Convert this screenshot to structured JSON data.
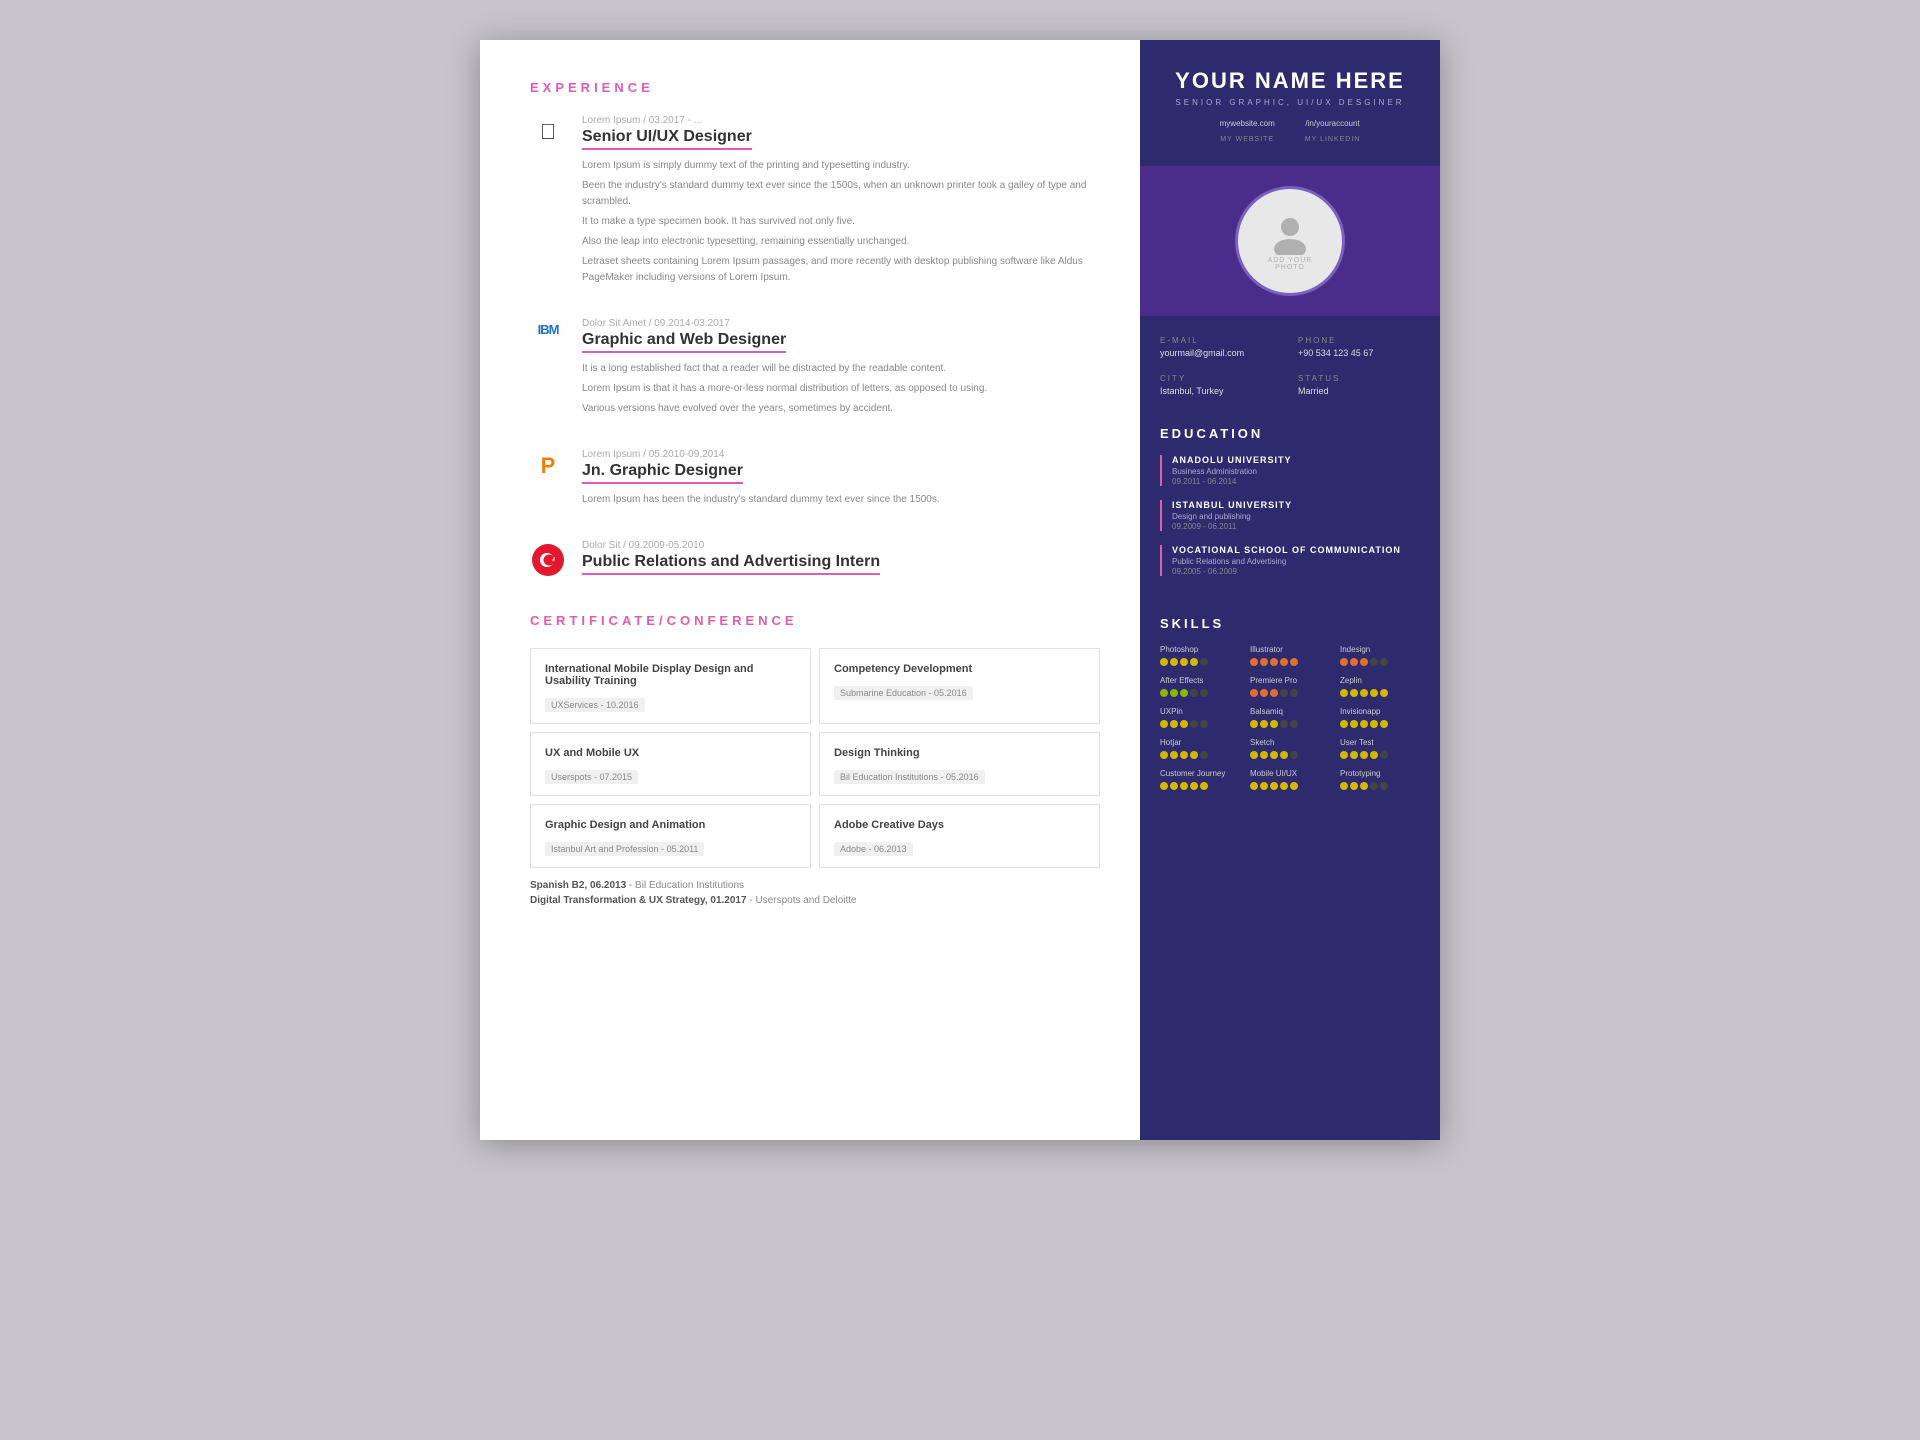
{
  "resume": {
    "left": {
      "experience_title": "EXPERIENCE",
      "items": [
        {
          "company": "Lorem Ipsum",
          "date": "Lorem Ipsum / 03.2017 - ...",
          "role": "Senior UI/UX Designer",
          "logo_type": "apple",
          "descriptions": [
            "Lorem Ipsum is simply dummy text of the printing and typesetting industry.",
            "Been the industry's standard dummy text ever since the 1500s, when an unknown printer took a galley of type and scrambled.",
            "It to make a type specimen book. It has survived not only five.",
            "Also the leap into electronic typesetting, remaining essentially unchanged.",
            "Letraset sheets containing Lorem Ipsum passages, and more recently with desktop publishing software like Aldus PageMaker including versions of Lorem Ipsum."
          ]
        },
        {
          "company": "IBM",
          "date": "Dolor Sit Amet / 09.2014-03.2017",
          "role": "Graphic and Web Designer",
          "logo_type": "ibm",
          "descriptions": [
            "It is a long established fact that a reader will be distracted by the readable content.",
            "Lorem Ipsum is that it has a more-or-less normal distribution of letters, as opposed to using.",
            "Various versions have evolved over the years, sometimes by accident."
          ]
        },
        {
          "company": "Lorem Ipsum",
          "date": "Lorem Ipsum / 05.2010-09.2014",
          "role": "Jn. Graphic Designer",
          "logo_type": "p",
          "descriptions": [
            "Lorem Ipsum has been the industry's standard dummy text ever since the 1500s."
          ]
        },
        {
          "company": "Dolor Sit",
          "date": "Dolor Sit / 09.2009-05.2010",
          "role": "Public Relations and Advertising Intern",
          "logo_type": "turkish",
          "descriptions": []
        }
      ],
      "cert_title": "CERTIFICATE/CONFERENCE",
      "certs": [
        {
          "name": "International Mobile Display Design and Usability Training",
          "org": "UXServices - 10.2016"
        },
        {
          "name": "Competency Development",
          "org": "Submarine Education - 05.2016"
        },
        {
          "name": "UX and Mobile UX",
          "org": "Userspots - 07.2015"
        },
        {
          "name": "Design Thinking",
          "org": "Bil Education Institutions - 05.2016"
        },
        {
          "name": "Graphic Design and Animation",
          "org": "Istanbul Art and Profession - 05.2011"
        },
        {
          "name": "Adobe Creative Days",
          "org": "Adobe - 06.2013"
        }
      ],
      "language_label": "Spanish B2, 06.2013",
      "language_org": "- Bil Education Institutions",
      "digital_label": "Digital Transformation & UX Strategy, 01.2017",
      "digital_org": "- Userspots and Deloitte"
    },
    "right": {
      "name": "YOUR NAME HERE",
      "subtitle": "Senior Graphic, UI/UX Desginer",
      "website_url": "mywebsite.com",
      "website_label": "MY WEBSITE",
      "linkedin_url": "/in/youraccount",
      "linkedin_label": "MY LINKEDIN",
      "photo_text1": "ADD YOUR",
      "photo_text2": "PHOTO",
      "email_label": "E-MAIL",
      "email_value": "yourmail@gmail.com",
      "phone_label": "PHONE",
      "phone_value": "+90 534 123 45 67",
      "city_label": "CITY",
      "city_value": "Istanbul, Turkey",
      "status_label": "STATUS",
      "status_value": "Married",
      "education_title": "EDUCATION",
      "education_items": [
        {
          "school": "Anadolu University",
          "degree": "Business Administration",
          "date": "09.2011 - 06.2014"
        },
        {
          "school": "Istanbul University",
          "degree": "Design and publishing",
          "date": "09.2009 - 06.2011"
        },
        {
          "school": "Vocational School of Communication",
          "degree": "Public Relations and Advertising",
          "date": "09.2005 - 06.2009"
        }
      ],
      "skills_title": "SKILLS",
      "skills": [
        {
          "name": "Photoshop",
          "filled": 4,
          "total": 5,
          "color": "yellow"
        },
        {
          "name": "Illustrator",
          "filled": 5,
          "total": 5,
          "color": "orange"
        },
        {
          "name": "Indesign",
          "filled": 3,
          "total": 5,
          "color": "orange"
        },
        {
          "name": "After Effects",
          "filled": 3,
          "total": 5,
          "color": "green"
        },
        {
          "name": "Premiere Pro",
          "filled": 3,
          "total": 5,
          "color": "orange"
        },
        {
          "name": "Zeplin",
          "filled": 5,
          "total": 5,
          "color": "yellow"
        },
        {
          "name": "UXPin",
          "filled": 3,
          "total": 5,
          "color": "yellow"
        },
        {
          "name": "Balsamiq",
          "filled": 3,
          "total": 5,
          "color": "yellow"
        },
        {
          "name": "Invisionapp",
          "filled": 5,
          "total": 5,
          "color": "yellow"
        },
        {
          "name": "Hotjar",
          "filled": 4,
          "total": 5,
          "color": "yellow"
        },
        {
          "name": "Sketch",
          "filled": 4,
          "total": 5,
          "color": "yellow"
        },
        {
          "name": "User Test",
          "filled": 4,
          "total": 5,
          "color": "yellow"
        },
        {
          "name": "Customer Journey",
          "filled": 5,
          "total": 5,
          "color": "yellow"
        },
        {
          "name": "Mobile UI/UX",
          "filled": 5,
          "total": 5,
          "color": "yellow"
        },
        {
          "name": "Prototyping",
          "filled": 3,
          "total": 5,
          "color": "yellow"
        }
      ]
    }
  }
}
